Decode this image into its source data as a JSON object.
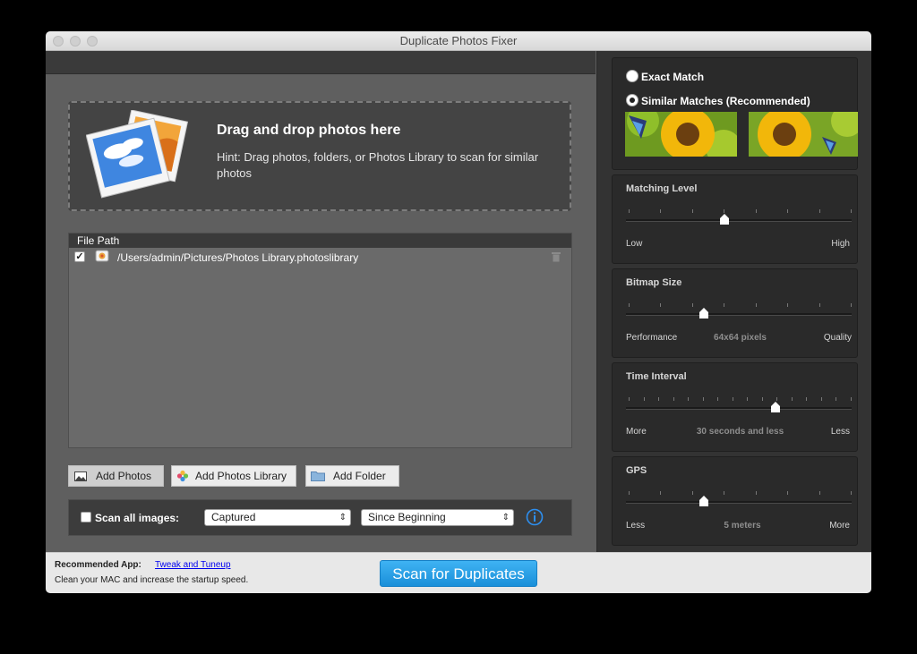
{
  "window": {
    "title": "Duplicate Photos Fixer"
  },
  "dropzone": {
    "title": "Drag and drop photos here",
    "hint": "Hint: Drag photos, folders, or Photos Library to scan for similar photos"
  },
  "file_list": {
    "header": "File Path",
    "rows": [
      {
        "checked": true,
        "path": "/Users/admin/Pictures/Photos Library.photoslibrary"
      }
    ]
  },
  "buttons": {
    "add_photos": "Add Photos",
    "add_photos_library": "Add Photos Library",
    "add_folder": "Add Folder"
  },
  "scan_options": {
    "scan_all_label": "Scan all images:",
    "scan_all_checked": false,
    "captured_value": "Captured",
    "since_value": "Since Beginning"
  },
  "match_mode": {
    "exact_label": "Exact Match",
    "similar_label": "Similar Matches (Recommended)",
    "selected": "similar"
  },
  "sliders": {
    "matching_level": {
      "title": "Matching Level",
      "low": "Low",
      "high": "High",
      "value": "",
      "position": 0.43
    },
    "bitmap_size": {
      "title": "Bitmap Size",
      "low": "Performance",
      "high": "Quality",
      "value": "64x64 pixels",
      "position": 0.34
    },
    "time_interval": {
      "title": "Time Interval",
      "low": "More",
      "high": "Less",
      "value": "30 seconds and less",
      "position": 0.66
    },
    "gps": {
      "title": "GPS",
      "low": "Less",
      "high": "More",
      "value": "5 meters",
      "position": 0.34
    }
  },
  "footer": {
    "recommended_label": "Recommended App:",
    "recommended_link": "Tweak and Tuneup",
    "recommended_desc": "Clean your MAC and increase the startup speed.",
    "scan_button": "Scan for Duplicates"
  },
  "colors": {
    "accent": "#1a8fd9",
    "panel": "#2a2a2a",
    "link": "#0000ee"
  }
}
